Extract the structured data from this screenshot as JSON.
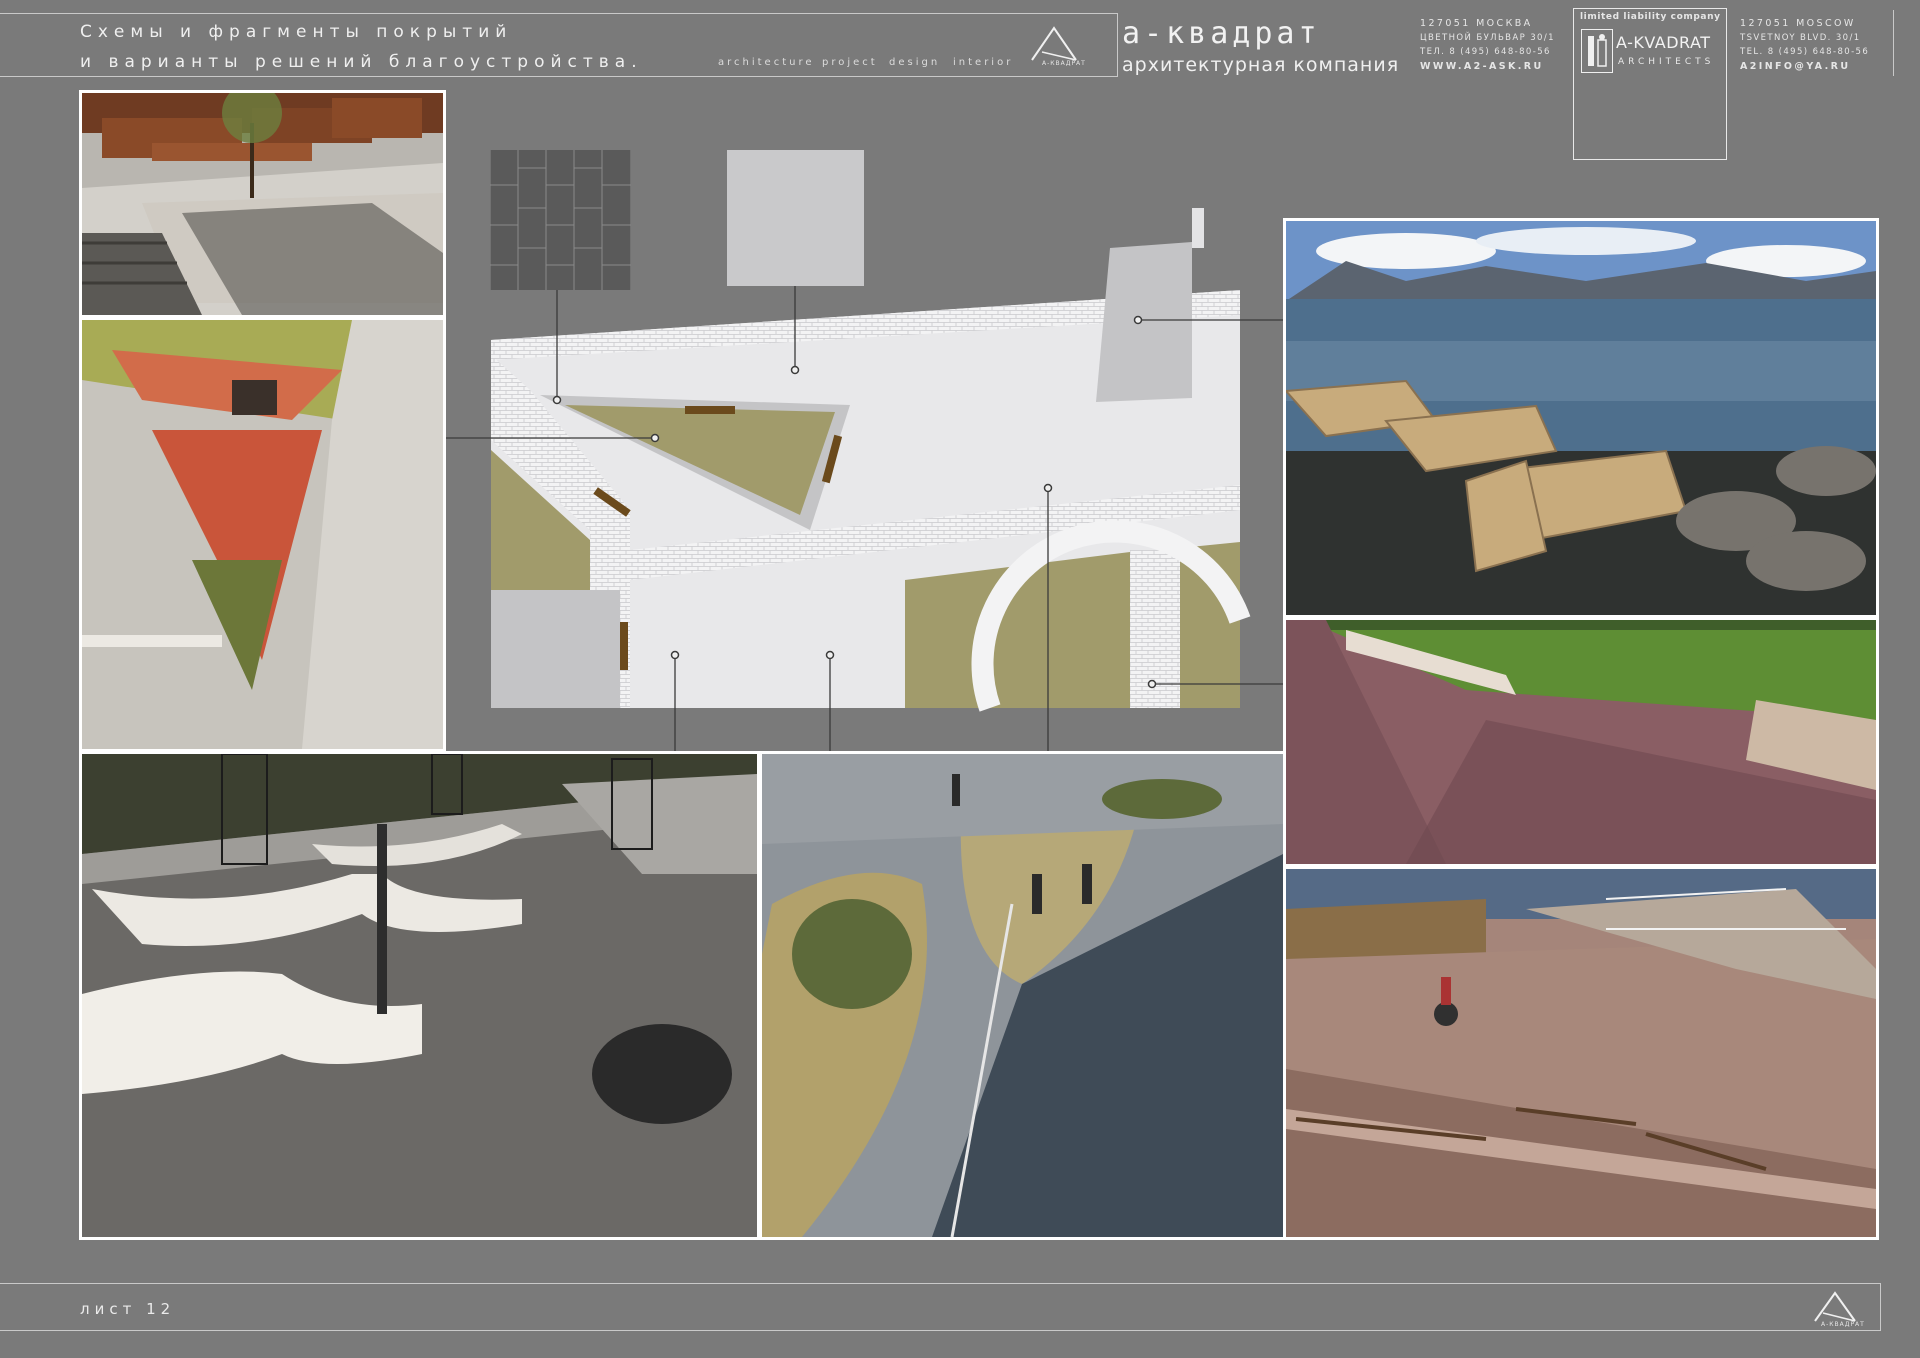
{
  "header": {
    "title_line1": "Схемы и фрагменты покрытий",
    "title_line2": "и варианты решений благоустройства.",
    "tagline": [
      "architecture",
      "project",
      "design",
      "interior"
    ],
    "logo_caption": "А-КВАДРАТ",
    "brand_name": "а-квадрат",
    "brand_subtitle": "архитектурная компания",
    "address_ru": [
      "127051 МОСКВА",
      "ЦВЕТНОЙ БУЛЬВАР 30/1",
      "ТЕЛ. 8 (495) 648-80-56",
      "WWW.A2-ASK.RU"
    ],
    "box_top": "limited liability company",
    "box_brand": "A-KVADRAT",
    "box_sub": "ARCHITECTS",
    "address_en": [
      "127051 MOSCOW",
      "TSVETNOY BLVD. 30/1",
      "TEL. 8 (495) 648-80-56",
      "A2INFO@YA.RU"
    ]
  },
  "footer": {
    "sheet": "лист 12",
    "logo_caption": "А-КВАДРАТ"
  },
  "colors": {
    "background": "#7a7a7a",
    "olive": "#a19b6b",
    "plan_light": "#e9e9eb",
    "plan_gray": "#c4c4c6",
    "bench_brown": "#6b4a1c"
  },
  "photos": [
    {
      "name": "photo-wooden-benches-plaza"
    },
    {
      "name": "photo-planted-triangle"
    },
    {
      "name": "photo-white-benches"
    },
    {
      "name": "photo-pedestrian-plaza"
    },
    {
      "name": "photo-waterfront-deck"
    },
    {
      "name": "photo-red-promenade"
    },
    {
      "name": "photo-boardwalk-cyclist"
    }
  ]
}
